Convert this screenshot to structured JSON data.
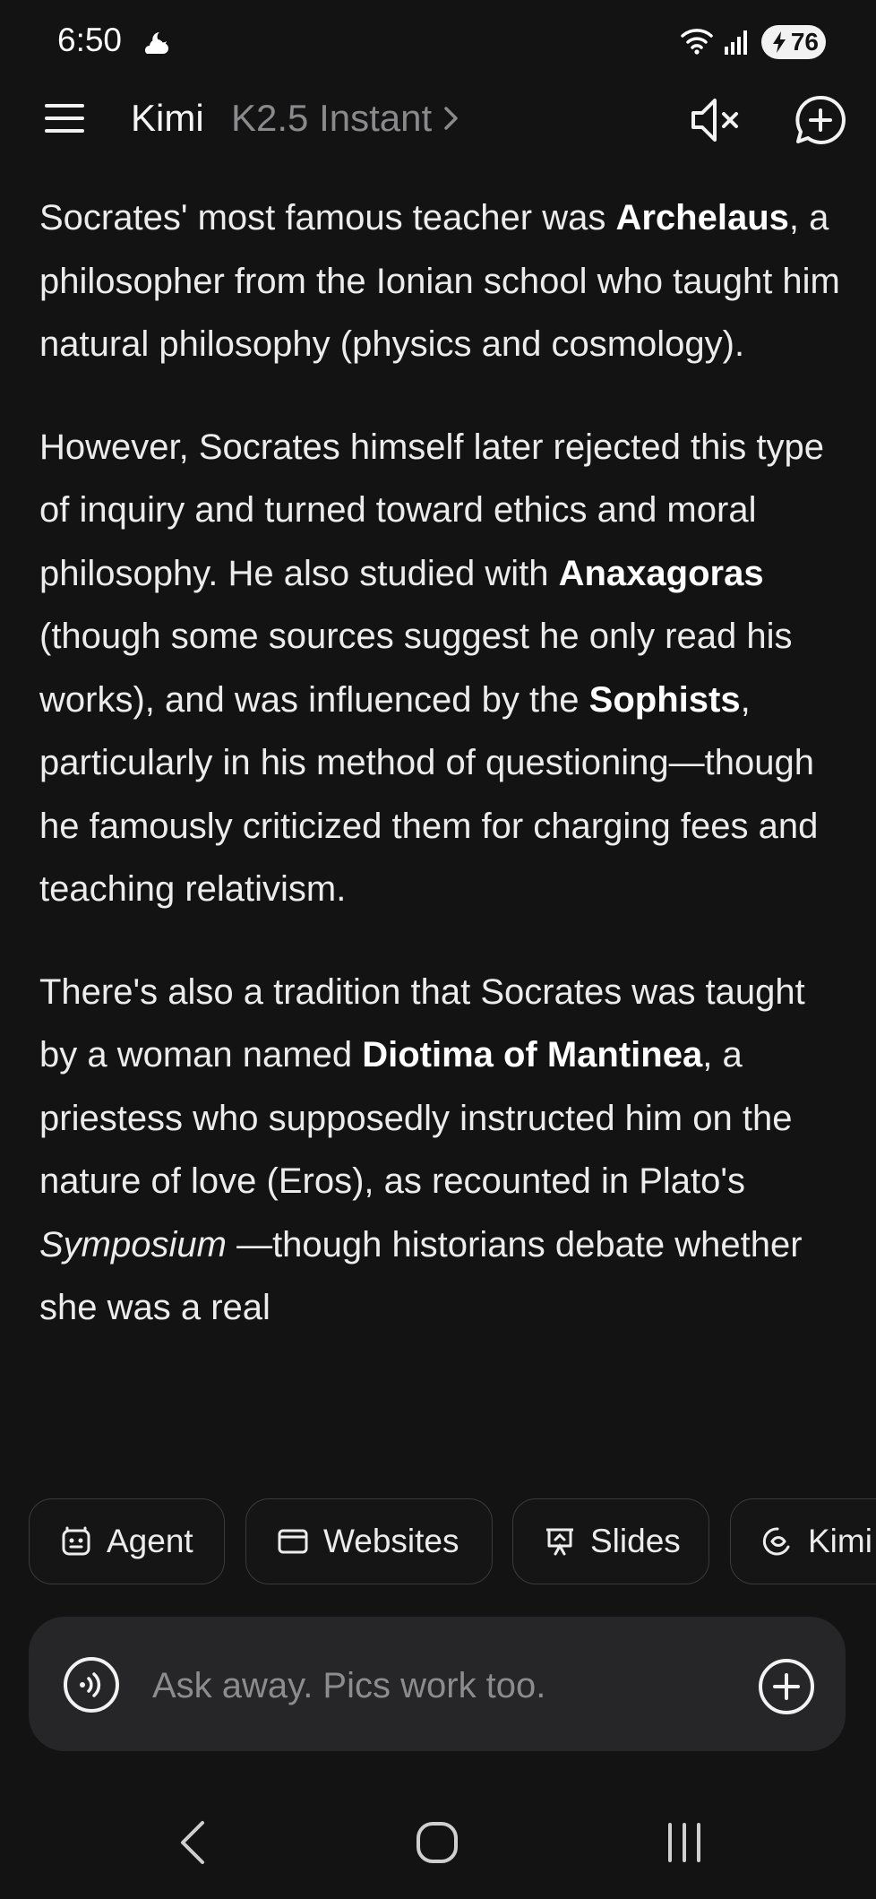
{
  "status_bar": {
    "time": "6:50",
    "weather_icon": "cloud-moon-icon",
    "wifi_icon": "wifi-icon",
    "signal_icon": "signal-icon",
    "battery": "76"
  },
  "header": {
    "title": "Kimi",
    "model": "K2.5 Instant",
    "mute_icon": "volume-mute-icon",
    "new_chat_icon": "new-chat-icon",
    "menu_icon": "menu-icon"
  },
  "message": {
    "p1": {
      "a": "Socrates' most famous teacher was ",
      "b": "Archelaus",
      "c": ", a philosopher from the Ionian school who taught him natural philosophy (physics and cosmology)."
    },
    "p2": {
      "a": "However, Socrates himself later rejected this type of inquiry and turned toward ethics and moral philosophy. He also studied with ",
      "b": "Anaxagoras",
      "c": " (though some sources suggest he only read his works), and was influenced by the ",
      "d": "Sophists",
      "e": ", particularly in his method of questioning—though he famously criticized them for charging fees and teaching relativism."
    },
    "p3": {
      "a": "There's also a tradition that Socrates was taught by a woman named ",
      "b": "Diotima of Mantinea",
      "c": ", a priestess who supposedly instructed him on the nature of love (Eros), as recounted in Plato's ",
      "d": "Symposium",
      "e": " —though historians debate whether she was a real"
    }
  },
  "chips": [
    {
      "label": "Agent",
      "icon": "agent-icon"
    },
    {
      "label": "Websites",
      "icon": "browser-window-icon"
    },
    {
      "label": "Slides",
      "icon": "presentation-icon"
    },
    {
      "label": "Kimi",
      "icon": "kimi-icon"
    }
  ],
  "input": {
    "placeholder": "Ask away. Pics work too.",
    "voice_icon": "voice-icon",
    "add_icon": "plus-circle-icon"
  },
  "nav": {
    "back": "back-icon",
    "home": "home-icon",
    "recents": "recents-icon"
  }
}
